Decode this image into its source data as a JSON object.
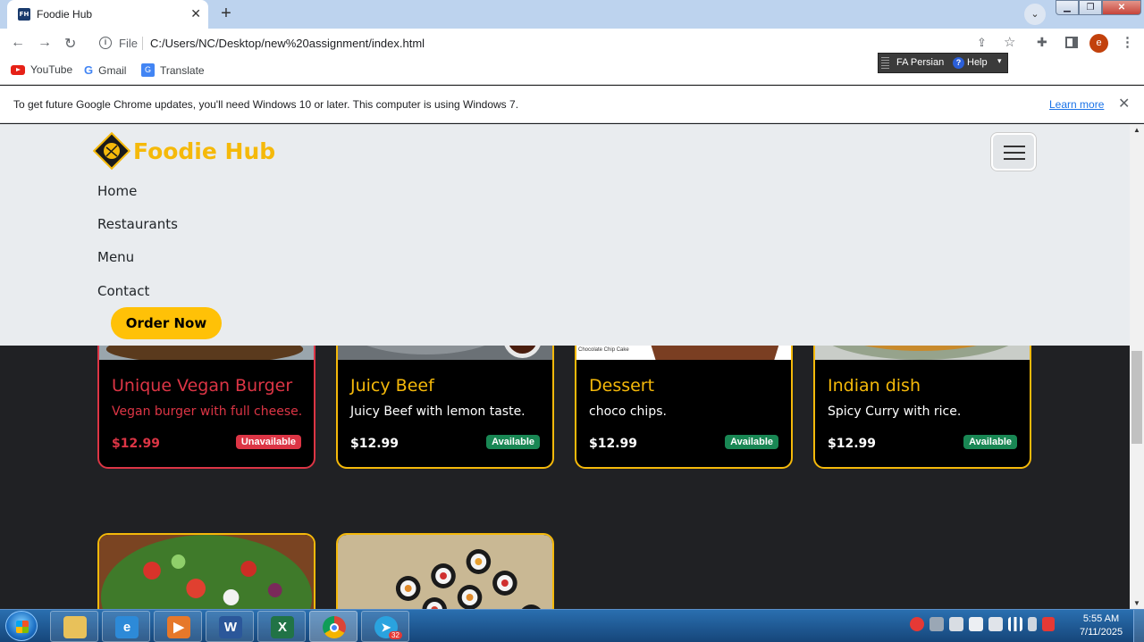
{
  "browser": {
    "tab": {
      "favicon_text": "FH",
      "title": "Foodie Hub",
      "close": "✕"
    },
    "new_tab": "+",
    "address": {
      "scheme_label": "File",
      "url": "C:/Users/NC/Desktop/new%20assignment/index.html"
    },
    "profile_initial": "e",
    "bookmarks": [
      {
        "label": "YouTube",
        "icon": "youtube-icon"
      },
      {
        "label": "Gmail",
        "icon": "google-icon"
      },
      {
        "label": "Translate",
        "icon": "translate-icon"
      }
    ],
    "language_bar": {
      "language": "FA Persian",
      "help": "Help"
    },
    "infobar": {
      "message": "To get future Google Chrome updates, you'll need Windows 10 or later. This computer is using Windows 7.",
      "link": "Learn more"
    }
  },
  "site": {
    "brand": "Foodie Hub",
    "nav_links": [
      "Home",
      "Restaurants",
      "Menu",
      "Contact"
    ],
    "cta": "Order Now",
    "cards": [
      {
        "title": "Unique Vegan Burger",
        "description": "Vegan burger with full cheese.",
        "price": "$12.99",
        "status": "Unavailable",
        "image_caption": ""
      },
      {
        "title": "Juicy Beef",
        "description": "Juicy Beef with lemon taste.",
        "price": "$12.99",
        "status": "Available",
        "image_caption": ""
      },
      {
        "title": "Dessert",
        "description": "choco chips.",
        "price": "$12.99",
        "status": "Available",
        "image_caption": "Chocolate Chip Cake"
      },
      {
        "title": "Indian dish",
        "description": "Spicy Curry with rice.",
        "price": "$12.99",
        "status": "Available",
        "image_caption": ""
      }
    ],
    "colors": {
      "accent": "#f5b90a",
      "available": "#198754",
      "unavailable": "#dc3545",
      "navbar_bg": "#e9ecef"
    }
  },
  "taskbar": {
    "time": "5:55 AM",
    "date": "7/11/2025",
    "telegram_badge": "32",
    "apps": [
      "file-explorer-icon",
      "internet-explorer-icon",
      "media-player-icon",
      "word-icon",
      "excel-icon",
      "chrome-icon",
      "telegram-icon"
    ]
  }
}
